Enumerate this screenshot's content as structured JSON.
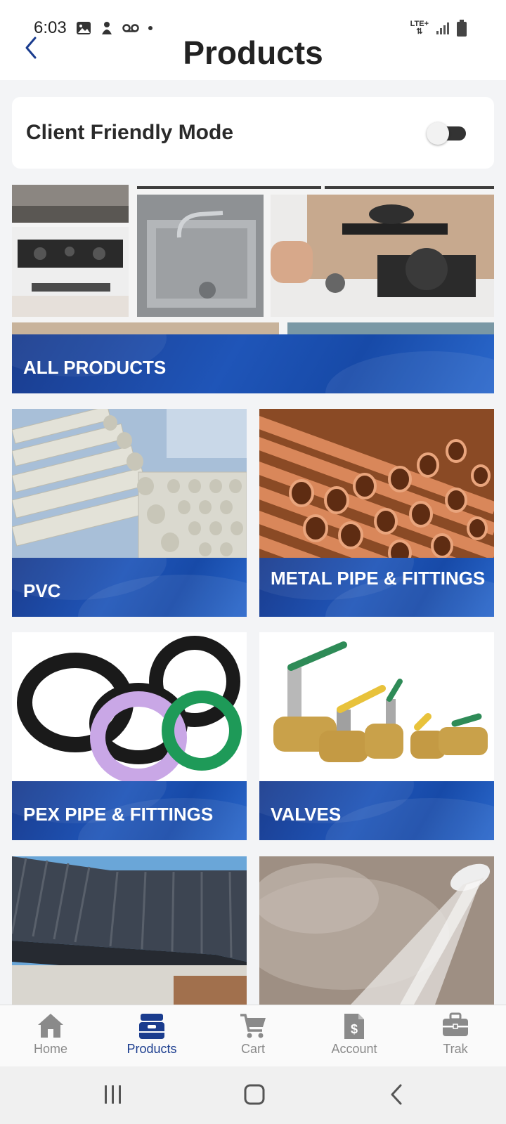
{
  "status_bar": {
    "time": "6:03",
    "network": "LTE+"
  },
  "header": {
    "title": "Products"
  },
  "client_mode": {
    "label": "Client Friendly Mode",
    "enabled": true
  },
  "categories": [
    {
      "label": "ALL PRODUCTS"
    },
    {
      "label": "PVC"
    },
    {
      "label": "METAL PIPE & FITTINGS"
    },
    {
      "label": "PEX PIPE & FITTINGS"
    },
    {
      "label": "VALVES"
    }
  ],
  "bottom_nav": [
    {
      "label": "Home",
      "icon": "home-icon"
    },
    {
      "label": "Products",
      "icon": "products-icon",
      "active": true
    },
    {
      "label": "Cart",
      "icon": "cart-icon"
    },
    {
      "label": "Account",
      "icon": "account-icon"
    },
    {
      "label": "Trak",
      "icon": "briefcase-icon"
    }
  ],
  "colors": {
    "brand_blue": "#1a3c8e",
    "accent_blue": "#1f55b8"
  }
}
